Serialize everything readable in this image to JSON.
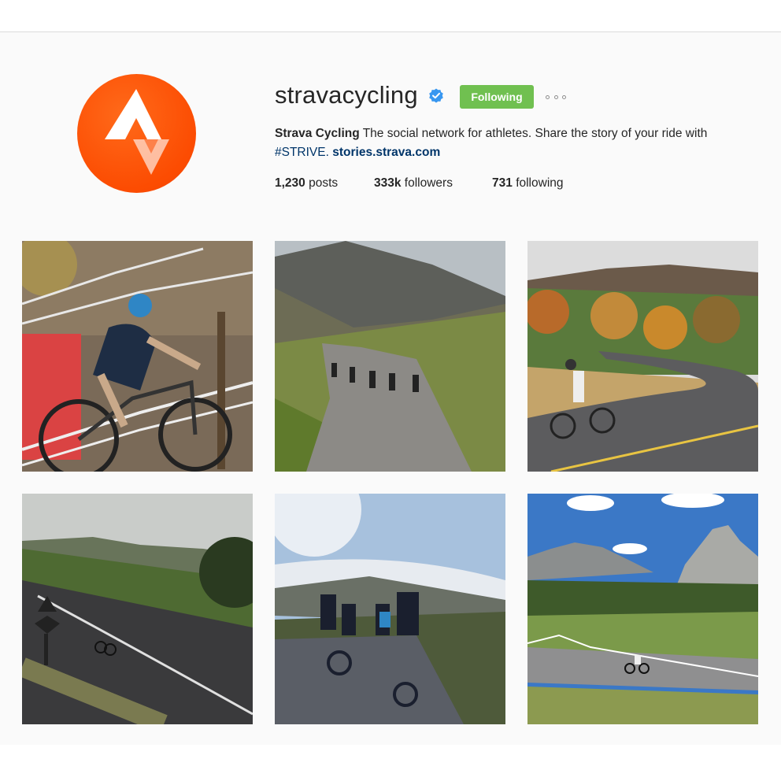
{
  "profile": {
    "username": "stravacycling",
    "verified": true,
    "follow_button": "Following",
    "more_options_icon": "ellipsis-icon",
    "full_name": "Strava Cycling",
    "bio_text": "The social network for athletes. Share the story of your ride with",
    "hashtag": "#STRIVE.",
    "website": "stories.strava.com"
  },
  "stats": {
    "posts_count": "1,230",
    "posts_label": "posts",
    "followers_count": "333k",
    "followers_label": "followers",
    "following_count": "731",
    "following_label": "following"
  },
  "colors": {
    "brand": "#fc4c02",
    "follow_button": "#70c050",
    "verified_badge": "#3897f0",
    "link": "#003569"
  },
  "posts": [
    {
      "icon": "photo-cyclocross-rider"
    },
    {
      "icon": "photo-mountain-road-group"
    },
    {
      "icon": "photo-autumn-hairpin"
    },
    {
      "icon": "photo-descent-road"
    },
    {
      "icon": "photo-riders-overlook"
    },
    {
      "icon": "photo-dolomites-road"
    }
  ]
}
